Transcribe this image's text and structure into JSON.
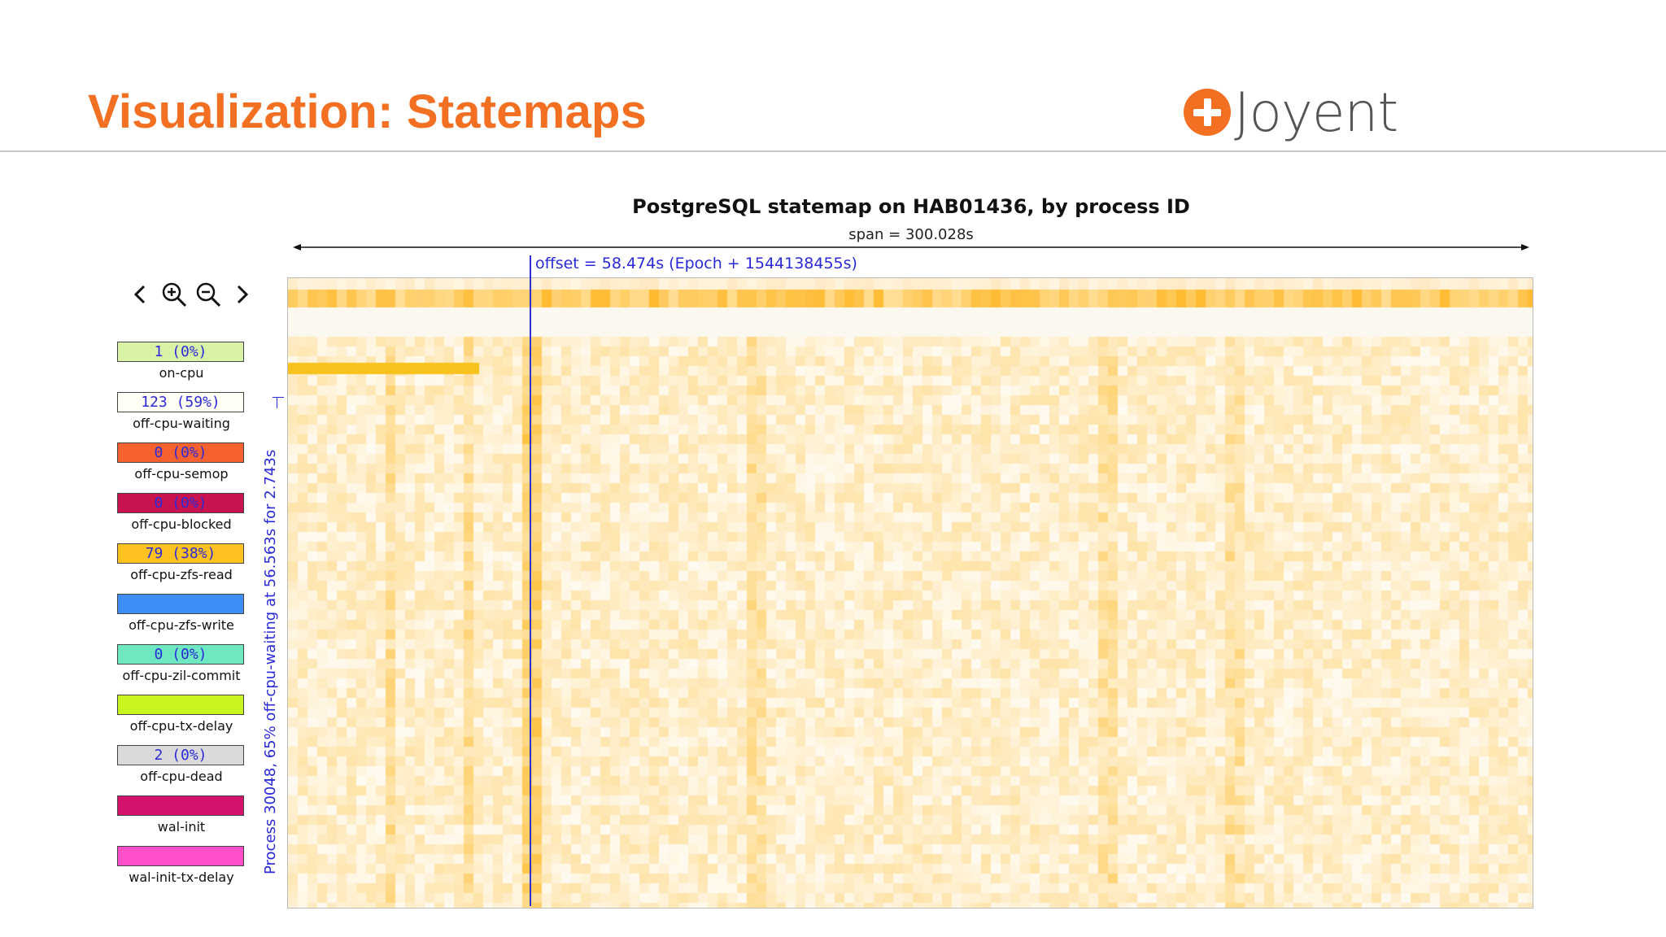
{
  "slide": {
    "title": "Visualization: Statemaps",
    "logo_text": "Joyent"
  },
  "statemap": {
    "title": "PostgreSQL statemap on HAB01436, by process ID",
    "span": "span = 300.028s",
    "offset": "offset = 58.474s (Epoch + 1544138455s)",
    "side_label": "Process 30048, 65% off-cpu-waiting at 56.563s for 2.743s"
  },
  "nav": {
    "prev_icon": "chevron-left-icon",
    "zoom_in_icon": "zoom-in-icon",
    "zoom_out_icon": "zoom-out-icon",
    "next_icon": "chevron-right-icon"
  },
  "legend": [
    {
      "label": "on-cpu",
      "value": "1 (0%)",
      "color": "#d9f3a6"
    },
    {
      "label": "off-cpu-waiting",
      "value": "123 (59%)",
      "color": "#fffef5"
    },
    {
      "label": "off-cpu-semop",
      "value": "0 (0%)",
      "color": "#f5612f"
    },
    {
      "label": "off-cpu-blocked",
      "value": "0 (0%)",
      "color": "#c8134f"
    },
    {
      "label": "off-cpu-zfs-read",
      "value": "79 (38%)",
      "color": "#ffc21f"
    },
    {
      "label": "off-cpu-zfs-write",
      "value": "",
      "color": "#3f8ef5"
    },
    {
      "label": "off-cpu-zil-commit",
      "value": "0 (0%)",
      "color": "#6ee8c0"
    },
    {
      "label": "off-cpu-tx-delay",
      "value": "",
      "color": "#c8f51f"
    },
    {
      "label": "off-cpu-dead",
      "value": "2 (0%)",
      "color": "#dadada"
    },
    {
      "label": "wal-init",
      "value": "",
      "color": "#d4126c"
    },
    {
      "label": "wal-init-tx-delay",
      "value": "",
      "color": "#ff4fc8"
    }
  ],
  "colors": {
    "accent": "#f36f21",
    "offset_line": "#3030d0",
    "zfs_read": "#ffc21f",
    "waiting": "#fffbef"
  }
}
